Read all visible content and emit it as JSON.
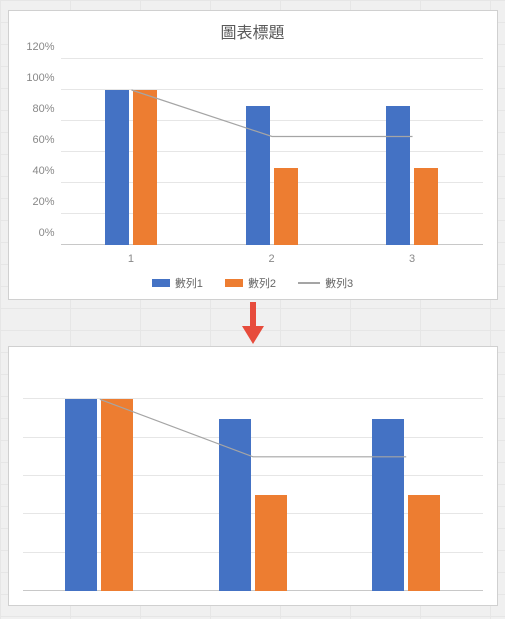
{
  "chart_data": [
    {
      "type": "bar",
      "title": "圖表標題",
      "categories": [
        "1",
        "2",
        "3"
      ],
      "series": [
        {
          "name": "數列1",
          "values": [
            100,
            90,
            90
          ],
          "style": "bar",
          "color": "#4472c4"
        },
        {
          "name": "數列2",
          "values": [
            100,
            50,
            50
          ],
          "style": "bar",
          "color": "#ed7d31"
        },
        {
          "name": "數列3",
          "values": [
            100,
            70,
            70
          ],
          "style": "line",
          "color": "#a5a5a5"
        }
      ],
      "ylabel": "",
      "xlabel": "",
      "ylim": [
        0,
        120
      ],
      "yticks": [
        "0%",
        "20%",
        "40%",
        "60%",
        "80%",
        "100%",
        "120%"
      ],
      "legend_position": "bottom",
      "has_axes": true
    },
    {
      "type": "bar",
      "title": "",
      "categories": [
        "1",
        "2",
        "3"
      ],
      "series": [
        {
          "name": "數列1",
          "values": [
            100,
            90,
            90
          ],
          "style": "bar",
          "color": "#4472c4"
        },
        {
          "name": "數列2",
          "values": [
            100,
            50,
            50
          ],
          "style": "bar",
          "color": "#ed7d31"
        },
        {
          "name": "數列3",
          "values": [
            100,
            70,
            70
          ],
          "style": "line",
          "color": "#a5a5a5"
        }
      ],
      "ylim": [
        0,
        120
      ],
      "has_axes": false,
      "legend_position": "none"
    }
  ],
  "arrow": {
    "direction": "down",
    "color": "#e74c3c"
  }
}
